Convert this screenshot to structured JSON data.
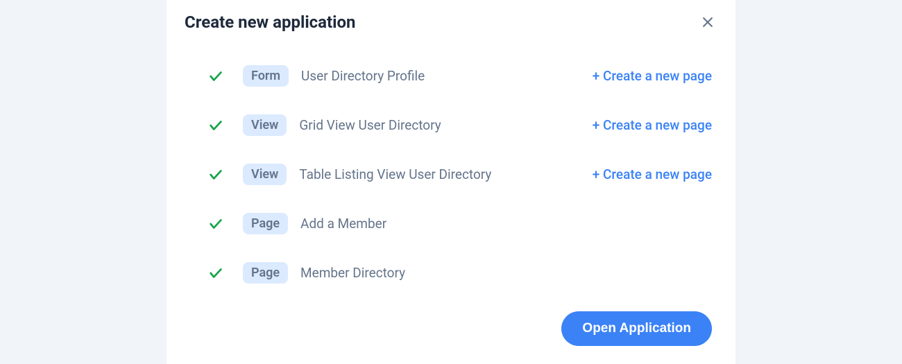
{
  "title": "Create new application",
  "items": [
    {
      "tag": "Form",
      "name": "User Directory Profile",
      "hasCreate": true
    },
    {
      "tag": "View",
      "name": "Grid View User Directory",
      "hasCreate": true
    },
    {
      "tag": "View",
      "name": "Table Listing View User Directory",
      "hasCreate": true
    },
    {
      "tag": "Page",
      "name": "Add a Member",
      "hasCreate": false
    },
    {
      "tag": "Page",
      "name": "Member Directory",
      "hasCreate": false
    }
  ],
  "createLinkLabel": "+ Create a new page",
  "openButton": "Open Application"
}
